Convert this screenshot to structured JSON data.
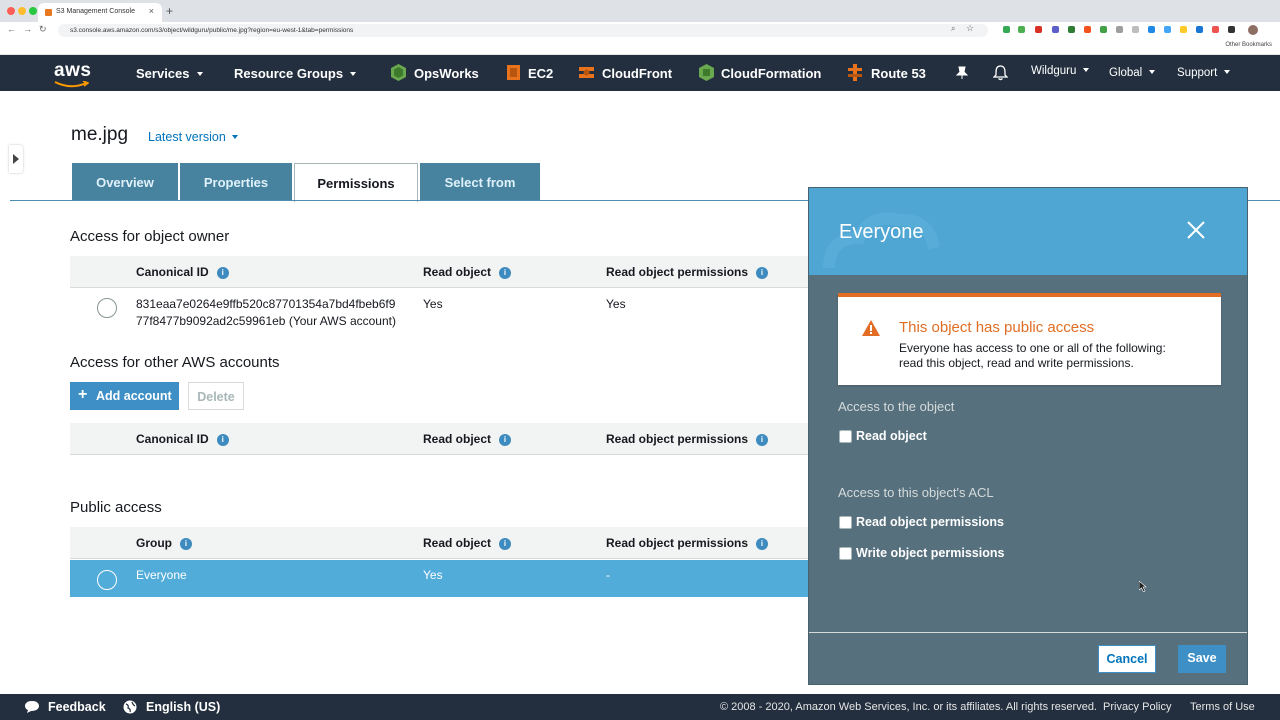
{
  "browser": {
    "tab_title": "S3 Management Console",
    "tab_close": "×",
    "new_tab": "+",
    "url": "s3.console.aws.amazon.com/s3/object/wildguru/public/me.jpg?region=eu-west-1&tab=permissions",
    "other_bookmarks": "Other Bookmarks"
  },
  "awsnav": {
    "logo": "aws",
    "services": "Services",
    "resource_groups": "Resource Groups",
    "opsworks": "OpsWorks",
    "ec2": "EC2",
    "cloudfront": "CloudFront",
    "cloudformation": "CloudFormation",
    "route53": "Route 53",
    "account": "Wildguru",
    "region": "Global",
    "support": "Support"
  },
  "object": {
    "name": "me.jpg",
    "version": "Latest version"
  },
  "tabs": [
    {
      "label": "Overview"
    },
    {
      "label": "Properties"
    },
    {
      "label": "Permissions"
    },
    {
      "label": "Select from"
    }
  ],
  "owner_section": {
    "heading": "Access for object owner",
    "columns": [
      "Canonical ID",
      "Read object",
      "Read object permissions"
    ],
    "row": {
      "id_line1": "831eaa7e0264e9ffb520c87701354a7bd4fbeb6f9",
      "id_line2": "77f8477b9092ad2c59961eb (Your AWS account)",
      "read": "Yes",
      "read_perm": "Yes"
    }
  },
  "other_section": {
    "heading": "Access for other AWS accounts",
    "add_button": "Add account",
    "delete_button": "Delete",
    "columns": [
      "Canonical ID",
      "Read object",
      "Read object permissions"
    ]
  },
  "public_section": {
    "heading": "Public access",
    "columns": [
      "Group",
      "Read object",
      "Read object permissions"
    ],
    "row": {
      "group": "Everyone",
      "read": "Yes",
      "read_perm": "-"
    }
  },
  "panel": {
    "title": "Everyone",
    "alert_title": "This object has public access",
    "alert_body_line1": "Everyone has access to one or all of the following:",
    "alert_body_line2": "read this object, read and write permissions.",
    "object_heading": "Access to the object",
    "read_object": "Read object",
    "acl_heading": "Access to this object's ACL",
    "read_perm": "Read object permissions",
    "write_perm": "Write object permissions",
    "cancel": "Cancel",
    "save": "Save"
  },
  "footer": {
    "feedback": "Feedback",
    "language": "English (US)",
    "copyright": "© 2008 - 2020, Amazon Web Services, Inc. or its affiliates. All rights reserved.",
    "privacy": "Privacy Policy",
    "terms": "Terms of Use"
  },
  "colors": {
    "nav_bg": "#232f3e",
    "accent": "#3e8fc6",
    "selected_row": "#52acd9",
    "panel_bg": "#57707e",
    "warning": "#e26d24"
  }
}
